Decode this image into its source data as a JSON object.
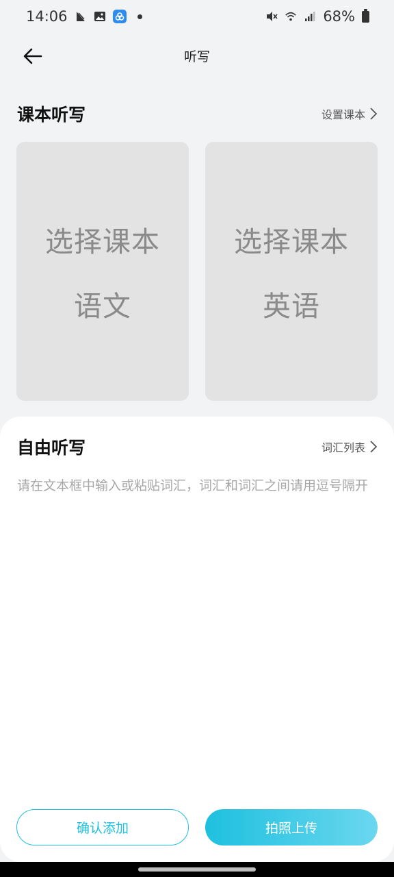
{
  "status_bar": {
    "time": "14:06",
    "battery": "68%",
    "icons": [
      "mute-icon",
      "wifi-icon",
      "signal-icon",
      "battery-icon"
    ]
  },
  "nav": {
    "title": "听写"
  },
  "textbook": {
    "title": "课本听写",
    "link": "设置课本",
    "cards": [
      {
        "line1": "选择课本",
        "line2": "语文"
      },
      {
        "line1": "选择课本",
        "line2": "英语"
      }
    ]
  },
  "free": {
    "title": "自由听写",
    "link": "词汇列表",
    "placeholder": "请在文本框中输入或粘贴词汇，词汇和词汇之间请用逗号隔开"
  },
  "buttons": {
    "confirm": "确认添加",
    "photo": "拍照上传"
  },
  "colors": {
    "accent": "#1ec0df",
    "card": "#e3e3e3"
  }
}
